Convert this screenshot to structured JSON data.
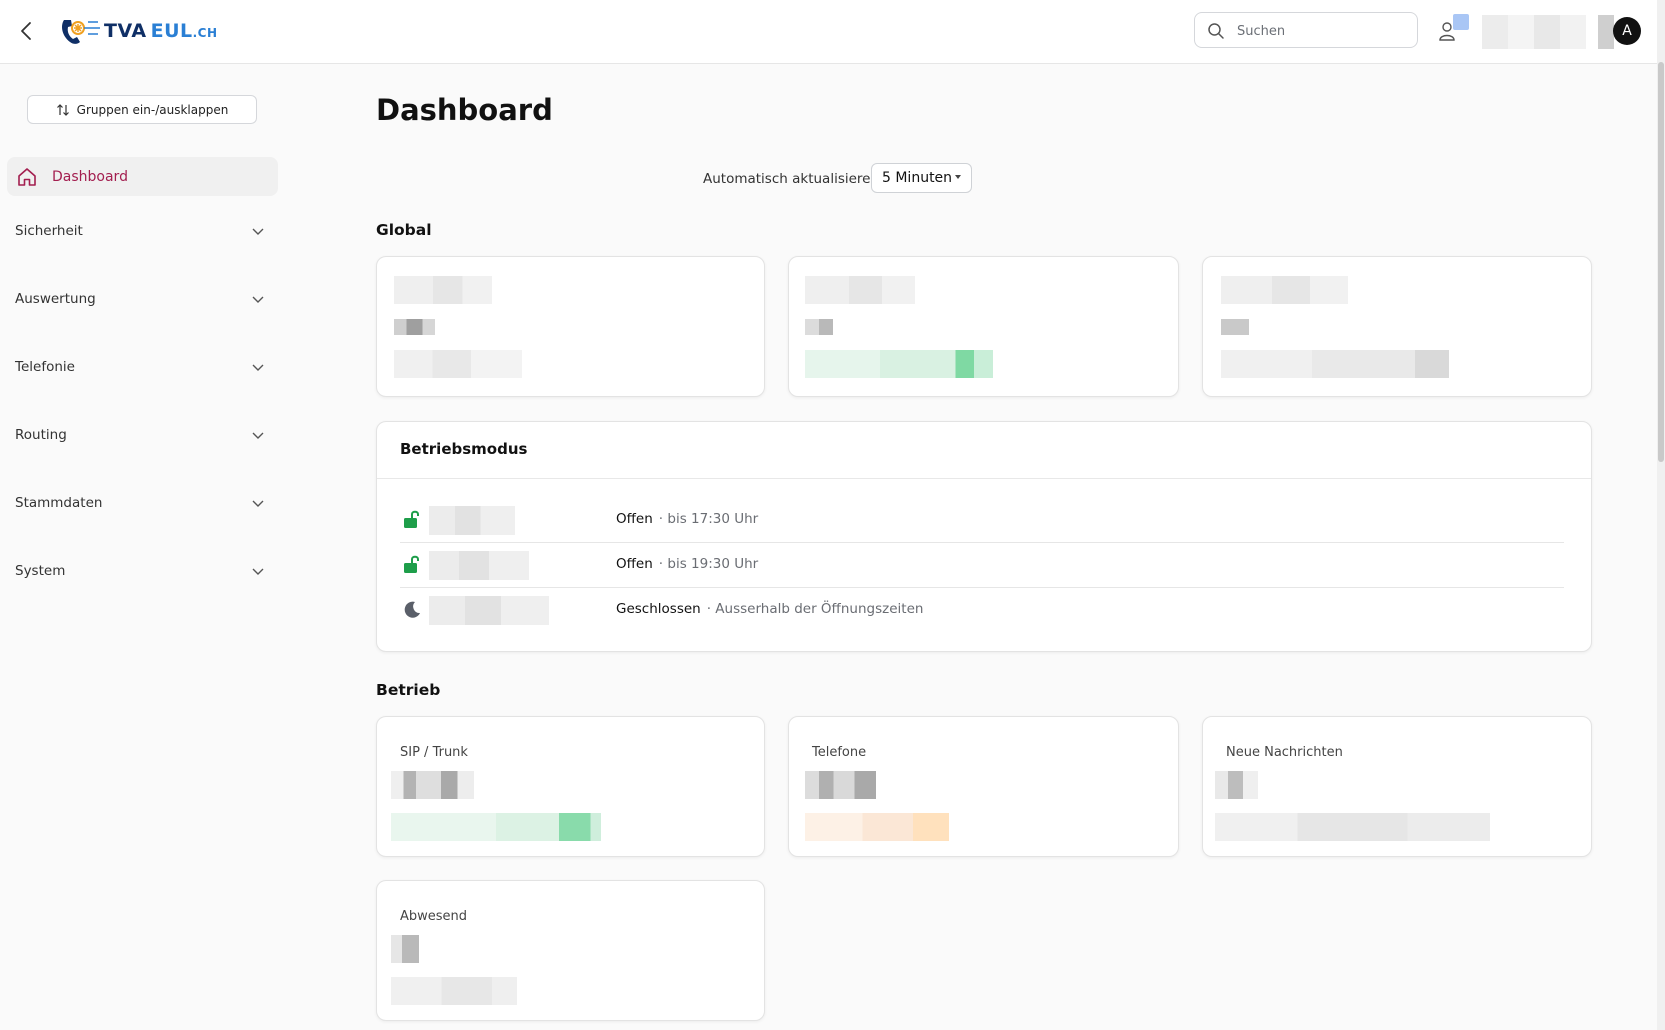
{
  "header": {
    "logo": {
      "tva": "TVA",
      "eul": "EUL",
      "ch": ".CH"
    },
    "search_placeholder": "Suchen",
    "avatar_initial": "A"
  },
  "sidebar": {
    "toggle_label": "Gruppen ein-/ausklappen",
    "active_item": "Dashboard",
    "groups": [
      "Sicherheit",
      "Auswertung",
      "Telefonie",
      "Routing",
      "Stammdaten",
      "System"
    ]
  },
  "main": {
    "title": "Dashboard",
    "refresh": {
      "label": "Automatisch aktualisieren:",
      "value": "5 Minuten"
    },
    "sections": {
      "global": "Global",
      "betriebsmodus": "Betriebsmodus",
      "betrieb": "Betrieb"
    },
    "betriebsmodus_rows": [
      {
        "status": "Offen",
        "detail": "· bis 17:30 Uhr",
        "icon": "unlock-icon"
      },
      {
        "status": "Offen",
        "detail": "· bis 19:30 Uhr",
        "icon": "unlock-icon"
      },
      {
        "status": "Geschlossen",
        "detail": "· Ausserhalb der Öffnungszeiten",
        "icon": "moon-icon"
      }
    ],
    "betrieb_cards": [
      "SIP / Trunk",
      "Telefone",
      "Neue Nachrichten",
      "Abwesend"
    ]
  },
  "colors": {
    "accent": "#a31e4f",
    "open_green": "#1e9e4a",
    "closed_gray": "#5a5f69",
    "logo_navy": "#0f2f66",
    "logo_blue": "#2a7fd4"
  }
}
